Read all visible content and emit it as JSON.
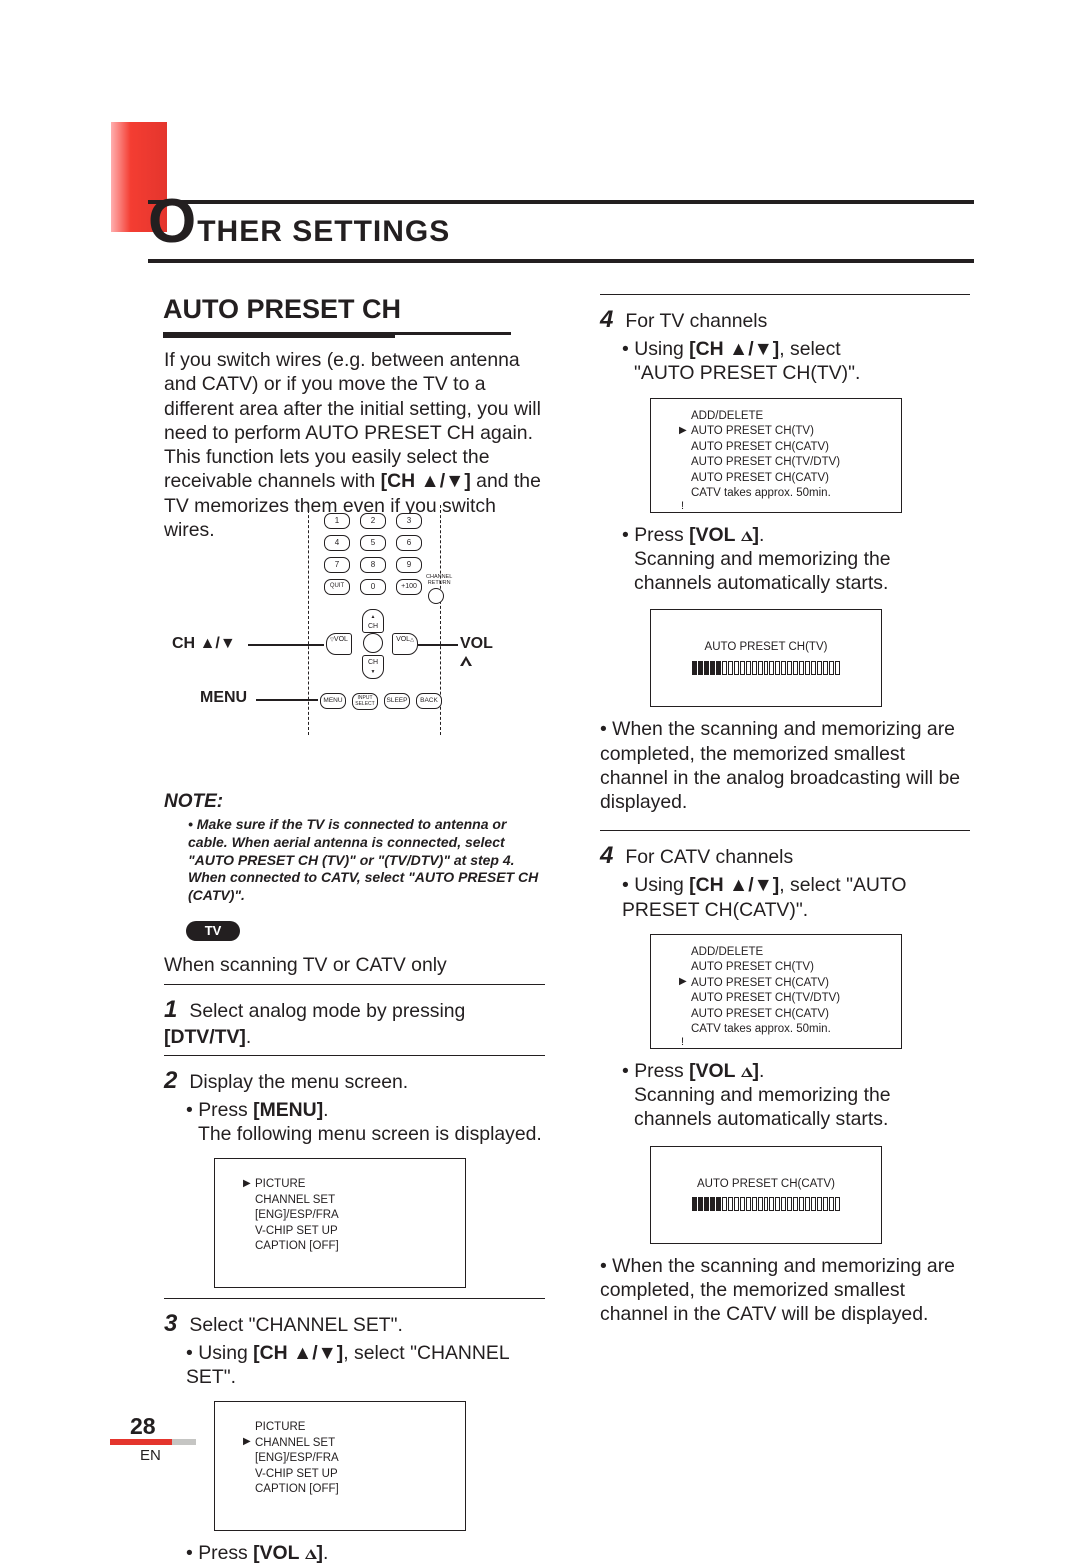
{
  "page": {
    "number": "28",
    "lang": "EN",
    "title_dropcap": "O",
    "title_rest": "THER SETTINGS",
    "subtitle": "AUTO PRESET CH"
  },
  "left": {
    "intro": "If you switch wires (e.g. between antenna and CATV) or if you move the TV to a different area after the initial setting, you will need to perform AUTO PRESET CH again. This function lets you easily select the receivable channels with ",
    "intro_tail": " and the TV memorizes them even if you switch wires.",
    "ch_bracket_open": "[CH ",
    "ch_bracket_close": "]",
    "note_title": "NOTE:",
    "note_body": "• Make sure if the TV is connected to antenna or cable. When aerial antenna is connected, select \"AUTO PRESET CH (TV)\" or \"(TV/DTV)\" at step 4.  When connected to CATV, select \"AUTO PRESET CH (CATV)\".",
    "tv_pill": "TV",
    "scan_only": "When scanning TV or CATV only",
    "s1": "Select analog mode by pressing ",
    "s1_btn": "[DTV/TV]",
    "s1_end": ".",
    "s2": "Display the menu screen.",
    "s2_bul_a": "Press ",
    "s2_bul_btn": "[MENU]",
    "s2_bul_b": ".",
    "s2_bul_c": "The following menu screen is displayed.",
    "s3": "Select \"CHANNEL SET\".",
    "s3_bul_a": "Using ",
    "s3_bul_b": ", select \"CHANNEL SET\".",
    "s3_bul_c": "Press ",
    "s3_btn2": "[VOL ",
    "s3_btn2_end": "]",
    "menu1": [
      "PICTURE",
      "CHANNEL SET",
      "[ENG]/ESP/FRA",
      "V-CHIP SET UP",
      "CAPTION [OFF]"
    ],
    "menu1_ptr_index": 0,
    "menu2": [
      "PICTURE",
      "CHANNEL SET",
      "[ENG]/ESP/FRA",
      "V-CHIP SET UP",
      "CAPTION [OFF]"
    ],
    "menu2_ptr_index": 1
  },
  "remote": {
    "lbl_ch": "CH ",
    "lbl_menu": "MENU",
    "lbl_vol": "VOL ",
    "keys_num": [
      "1",
      "2",
      "3",
      "4",
      "5",
      "6",
      "7",
      "8",
      "9",
      "",
      "0",
      "+100"
    ],
    "key_left_of_0": "QUIT",
    "key_extra": "CHANNEL RETURN",
    "dpad_up": "CH",
    "dpad_dn": "CH",
    "dpad_lf": "VOL",
    "dpad_rt": "VOL",
    "bottom": [
      "MENU",
      "INPUT SELECT",
      "SLEEP",
      "BACK"
    ]
  },
  "right": {
    "s4a_hdr": "For TV channels",
    "s4a_b1_a": "Using ",
    "s4a_b1_b": ", select",
    "s4a_b1_c": "\"AUTO PRESET CH(TV)\".",
    "s4a_b2_a": "Press ",
    "s4a_b2_b": ".",
    "s4a_b2_c": "Scanning and memorizing the channels automatically starts.",
    "s4a_b3": "• When the scanning and memorizing are completed, the memorized smallest channel in the analog broadcasting will be displayed.",
    "s4b_hdr": "For CATV channels",
    "s4b_b1_a": "Using ",
    "s4b_b1_b": ", select \"AUTO PRESET CH(CATV)\".",
    "s4b_b2_a": "Press ",
    "s4b_b2_b": ".",
    "s4b_b2_c": "Scanning and memorizing the channels automatically starts.",
    "s4b_b3": "• When the scanning and memorizing are completed, the memorized smallest channel in the CATV will be displayed.",
    "menuA": [
      "ADD/DELETE",
      "AUTO PRESET CH(TV)",
      "AUTO PRESET CH(CATV)",
      "AUTO PRESET CH(TV/DTV)",
      "AUTO PRESET CH(CATV)",
      "CATV takes approx. 50min."
    ],
    "menuA_ptr_index": 1,
    "menuA_excl_index": 5,
    "menuB": [
      "ADD/DELETE",
      "AUTO PRESET CH(TV)",
      "AUTO PRESET CH(CATV)",
      "AUTO PRESET CH(TV/DTV)",
      "AUTO PRESET CH(CATV)",
      "CATV takes approx. 50min."
    ],
    "menuB_ptr_index": 2,
    "menuB_excl_index": 5,
    "scanA": "AUTO PRESET CH(TV)",
    "scanB": "AUTO PRESET CH(CATV)"
  }
}
